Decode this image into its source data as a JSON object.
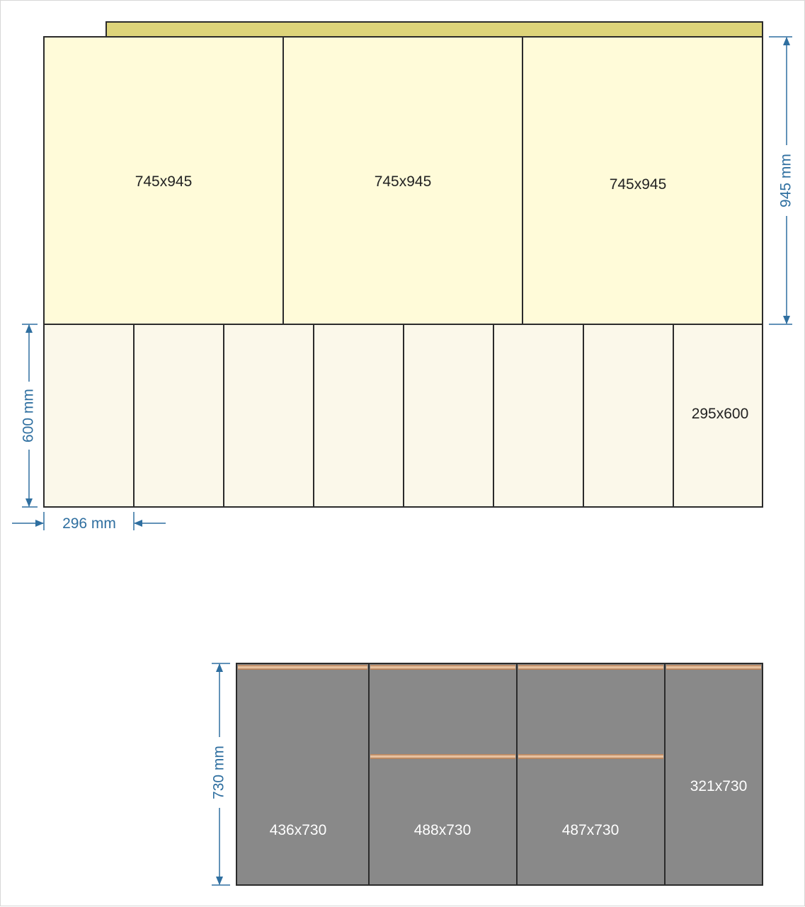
{
  "colors": {
    "top_strip": "#ddd47a",
    "upper_panel": "#fffbd9",
    "lower_panel": "#fbf8ea",
    "dark_panel": "#898989",
    "handle": "#d9a77f",
    "dimension": "#2f6fa0",
    "outline": "#2b2b2b"
  },
  "wall_cabinets": {
    "upper_doors": [
      {
        "label": "745x945"
      },
      {
        "label": "745x945"
      },
      {
        "label": "745x945"
      }
    ],
    "lower_doors": [
      {
        "label": ""
      },
      {
        "label": ""
      },
      {
        "label": ""
      },
      {
        "label": ""
      },
      {
        "label": ""
      },
      {
        "label": ""
      },
      {
        "label": ""
      },
      {
        "label": "295x600"
      }
    ],
    "dimensions": {
      "upper_height": "945 mm",
      "lower_height": "600 mm",
      "lower_door_width": "296 mm"
    }
  },
  "base_cabinets": {
    "doors": [
      {
        "label": "436x730",
        "handles": 1
      },
      {
        "label": "488x730",
        "handles": 2
      },
      {
        "label": "487x730",
        "handles": 2
      },
      {
        "label": "321x730",
        "handles": 1
      }
    ],
    "dimensions": {
      "height": "730 mm"
    }
  }
}
